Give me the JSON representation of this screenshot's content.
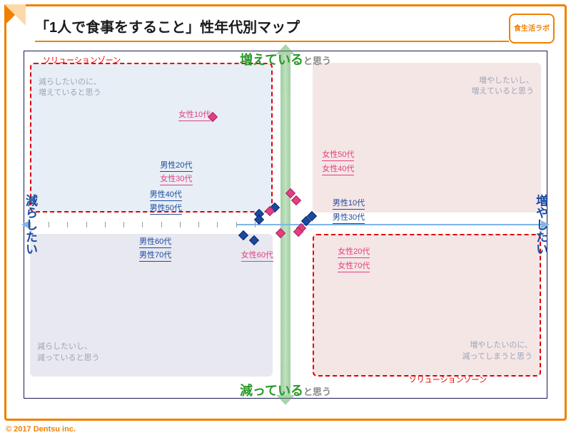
{
  "title": "「1人で食事をすること」性年代別マップ",
  "logo_text": "食生活ラボ",
  "axis": {
    "top_big": "増えている",
    "top_small": "と思う",
    "bottom_big": "減っている",
    "bottom_small": "と思う",
    "left": "減らしたい",
    "right": "増やしたい"
  },
  "quadrants": {
    "tl": "減らしたいのに、\n増えていると思う",
    "tr": "増やしたいし、\n増えていると思う",
    "bl": "減らしたいし、\n減っていると思う",
    "br": "増やしたいのに、\n減ってしまうと思う"
  },
  "zone_label": "ソリューションゾーン",
  "points": {
    "m10": "男性10代",
    "m20": "男性20代",
    "m30": "男性30代",
    "m40": "男性40代",
    "m50": "男性50代",
    "m60": "男性60代",
    "m70": "男性70代",
    "f10": "女性10代",
    "f20": "女性20代",
    "f30": "女性30代",
    "f40": "女性40代",
    "f50": "女性50代",
    "f60": "女性60代",
    "f70": "女性70代"
  },
  "copyright": "© 2017 Dentsu inc.",
  "chart_data": {
    "type": "scatter",
    "title": "「1人で食事をすること」性年代別マップ",
    "xlabel": "減らしたい ↔ 増やしたい",
    "ylabel": "減っていると思う ↔ 増えていると思う",
    "xlim": [
      -1,
      1
    ],
    "ylim": [
      -1,
      1
    ],
    "series": [
      {
        "name": "男性",
        "color": "#1a4aa0",
        "points": [
          {
            "label": "男性10代",
            "x": 0.1,
            "y": 0.05
          },
          {
            "label": "男性20代",
            "x": -0.04,
            "y": 0.1
          },
          {
            "label": "男性30代",
            "x": 0.08,
            "y": 0.02
          },
          {
            "label": "男性40代",
            "x": -0.1,
            "y": 0.06
          },
          {
            "label": "男性50代",
            "x": -0.1,
            "y": 0.03
          },
          {
            "label": "男性60代",
            "x": -0.16,
            "y": -0.06
          },
          {
            "label": "男性70代",
            "x": -0.12,
            "y": -0.09
          }
        ]
      },
      {
        "name": "女性",
        "color": "#e04080",
        "points": [
          {
            "label": "女性10代",
            "x": -0.28,
            "y": 0.62
          },
          {
            "label": "女性20代",
            "x": 0.06,
            "y": -0.02
          },
          {
            "label": "女性30代",
            "x": -0.06,
            "y": 0.08
          },
          {
            "label": "女性40代",
            "x": 0.04,
            "y": 0.14
          },
          {
            "label": "女性50代",
            "x": 0.02,
            "y": 0.18
          },
          {
            "label": "女性60代",
            "x": -0.02,
            "y": -0.05
          },
          {
            "label": "女性70代",
            "x": 0.05,
            "y": -0.04
          }
        ]
      }
    ],
    "zones": [
      {
        "name": "ソリューションゾーン",
        "quadrant": "top-left"
      },
      {
        "name": "ソリューションゾーン",
        "quadrant": "bottom-right"
      }
    ]
  }
}
